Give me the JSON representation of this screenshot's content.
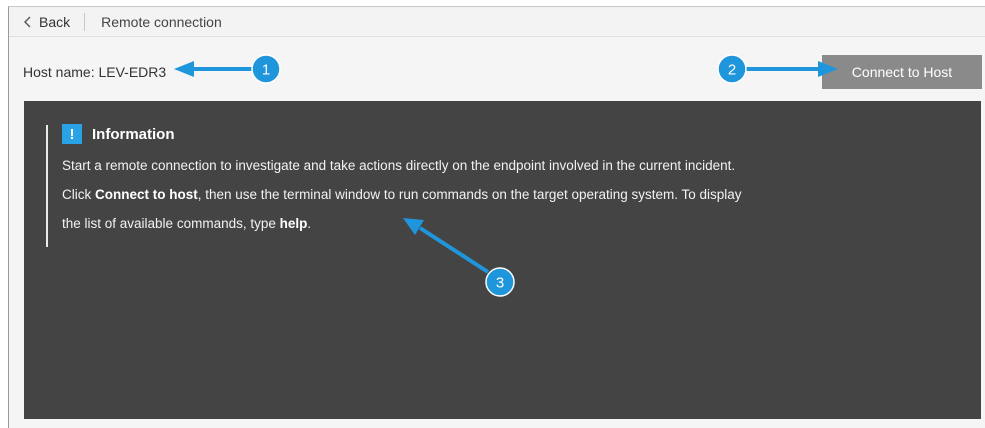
{
  "topbar": {
    "back_label": "Back",
    "breadcrumb": "Remote connection"
  },
  "host": {
    "label": "Host name:",
    "value": "LEV-EDR3"
  },
  "actions": {
    "connect_label": "Connect to Host"
  },
  "info": {
    "title": "Information",
    "line1": "Start a remote connection to investigate and take actions directly on the endpoint involved in the current incident.",
    "line2_pre": "Click ",
    "line2_bold": "Connect to host",
    "line2_post": ", then use the terminal window to run commands on the target operating system. To display",
    "line3_pre": "the list of available commands, type ",
    "line3_bold": "help",
    "line3_post": "."
  },
  "callouts": [
    "1",
    "2",
    "3"
  ],
  "colors": {
    "accent": "#1f96dc",
    "panel": "#444444",
    "button": "#8a8a8a"
  }
}
